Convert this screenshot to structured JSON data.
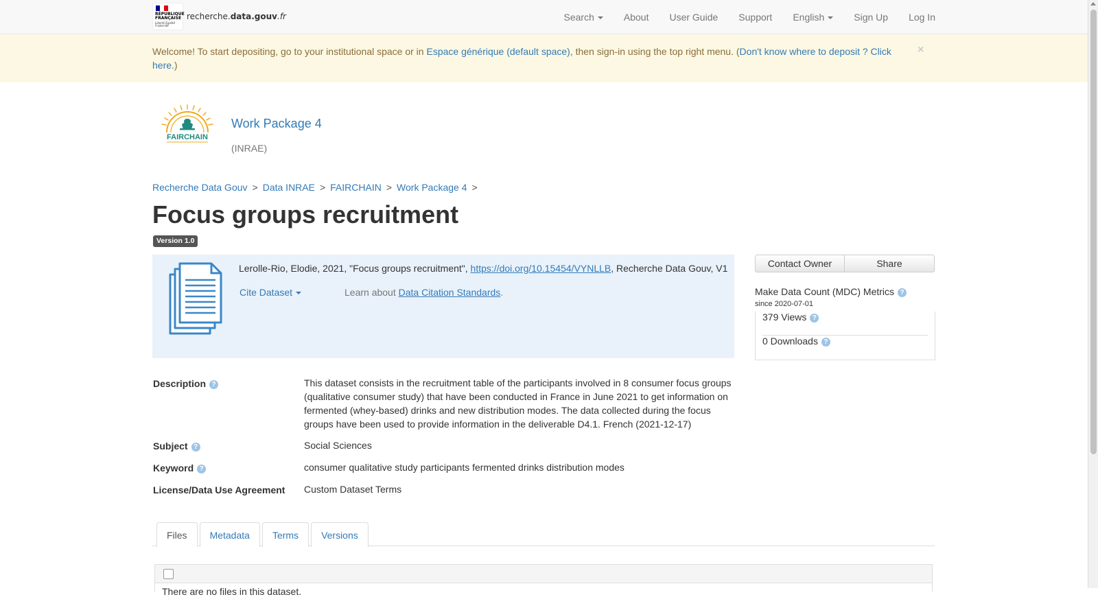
{
  "navbar": {
    "logo": {
      "republic_line1": "RÉPUBLIQUE",
      "republic_line2": "FRANÇAISE",
      "motto": "Liberté Égalité Fraternité",
      "site_prefix": "recherche.",
      "site_bold": "data.gouv",
      "site_suffix": ".fr"
    },
    "items": {
      "search": "Search",
      "about": "About",
      "user_guide": "User Guide",
      "support": "Support",
      "language": "English",
      "sign_up": "Sign Up",
      "log_in": "Log In"
    }
  },
  "alert": {
    "text_before": "Welcome! To start depositing, go to your institutional space or in ",
    "link1": "Espace générique (default space)",
    "text_middle": ", then sign-in using the top right menu. (",
    "link2": "Don't know where to deposit ? Click here.",
    "text_after": ")",
    "close": "×"
  },
  "dataverse": {
    "logo_text": "FAIRCHAIN",
    "name": "Work Package 4",
    "affiliation": "(INRAE)"
  },
  "breadcrumb": {
    "items": [
      "Recherche Data Gouv",
      "Data INRAE",
      "FAIRCHAIN",
      "Work Package 4"
    ],
    "separator": ">"
  },
  "dataset": {
    "title": "Focus groups recruitment",
    "version": "Version 1.0"
  },
  "citation": {
    "text": "Lerolle-Rio, Elodie, 2021, \"Focus groups recruitment\", ",
    "doi": "https://doi.org/10.15454/VYNLLB",
    "suffix": ", Recherche Data Gouv, V1",
    "cite_button": "Cite Dataset",
    "learn_prefix": "Learn about ",
    "learn_link": "Data Citation Standards",
    "learn_suffix": "."
  },
  "actions": {
    "contact_owner": "Contact Owner",
    "share": "Share"
  },
  "metrics": {
    "title": "Make Data Count (MDC) Metrics",
    "since": "since 2020-07-01",
    "views": "379 Views",
    "downloads": "0 Downloads"
  },
  "metadata": {
    "description_label": "Description",
    "description": "This dataset consists in the recruitment table of the participants involved in 8 consumer focus groups (qualitative consumer study) that have been conducted in France in June 2021 to get information on fermented (whey-based) drinks and new distribution modes. The data collected during the focus groups have been used to provide information in the deliverable D4.1. French (2021-12-17)",
    "subject_label": "Subject",
    "subject": "Social Sciences",
    "keyword_label": "Keyword",
    "keyword": "consumer qualitative study participants fermented drinks distribution modes",
    "license_label": "License/Data Use Agreement",
    "license": "Custom Dataset Terms"
  },
  "tabs": {
    "files": "Files",
    "metadata": "Metadata",
    "terms": "Terms",
    "versions": "Versions"
  },
  "files": {
    "note": "There are no files in this dataset."
  },
  "colors": {
    "link": "#337ab7",
    "alert_bg": "#fcf8e3",
    "alert_text": "#8a6d3b",
    "citation_bg": "#e9f2fa"
  }
}
